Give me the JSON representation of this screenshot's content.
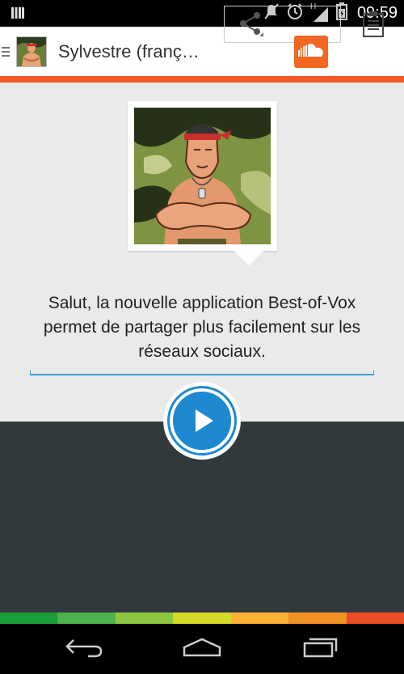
{
  "status_bar": {
    "time": "09:59",
    "network_label": "H",
    "icons": [
      "notification-bars-icon",
      "mute-icon",
      "alarm-icon",
      "signal-icon",
      "battery-icon"
    ]
  },
  "action_bar": {
    "title": "Sylvestre (franç…",
    "icons": [
      "drawer-icon",
      "app-icon",
      "share-icon",
      "soundcloud-icon",
      "clipboard-icon"
    ]
  },
  "main": {
    "avatar": "muscular-character-illustration",
    "message": "Salut, la nouvelle application Best-of-Vox permet de partager plus facilement sur les réseaux sociaux.",
    "play_icon": "play-icon"
  },
  "colors": {
    "accent": "#f05a24",
    "soundcloud": "#f26722",
    "play": "#1e88d0",
    "content_bg": "#eaeaea",
    "dark_bg": "#32393c",
    "color_bar": [
      "#1b9d3a",
      "#4db34a",
      "#8dc63f",
      "#d6d82a",
      "#f9b233",
      "#f39224",
      "#e94e24"
    ]
  },
  "nav_bar": {
    "icons": [
      "back-icon",
      "home-icon",
      "recent-apps-icon"
    ]
  }
}
